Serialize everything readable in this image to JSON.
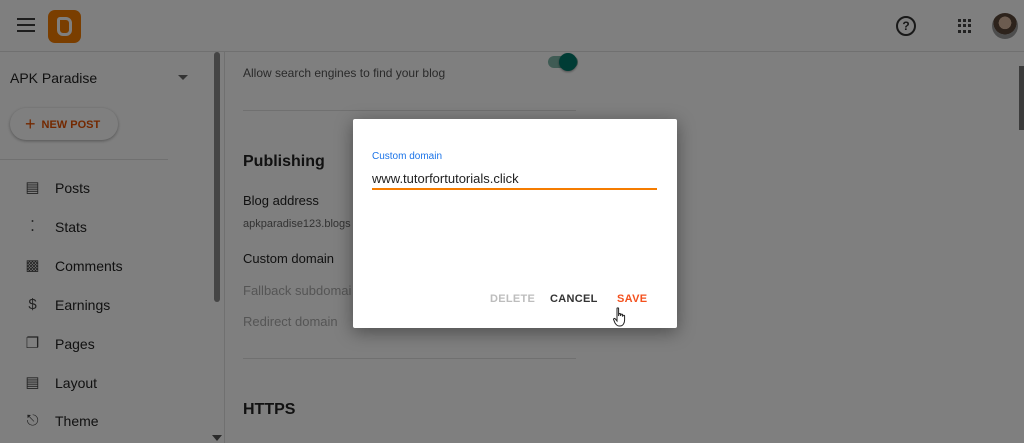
{
  "header": {
    "menu_icon": "hamburger-icon",
    "logo_icon": "blogger-logo",
    "help_icon": "help-circle-icon",
    "apps_icon": "grid-apps-icon"
  },
  "sidebar": {
    "blog_name": "APK Paradise",
    "new_post_label": "NEW POST",
    "items": [
      {
        "label": "Posts",
        "icon": "posts-icon"
      },
      {
        "label": "Stats",
        "icon": "stats-icon"
      },
      {
        "label": "Comments",
        "icon": "comments-icon"
      },
      {
        "label": "Earnings",
        "icon": "dollar-icon"
      },
      {
        "label": "Pages",
        "icon": "pages-icon"
      },
      {
        "label": "Layout",
        "icon": "layout-icon"
      },
      {
        "label": "Theme",
        "icon": "theme-icon"
      }
    ]
  },
  "settings": {
    "search_engines_text": "Allow search engines to find your blog",
    "search_engines_toggle": "on",
    "publishing_title": "Publishing",
    "blog_address_label": "Blog address",
    "blog_address_value": "apkparadise123.blogs",
    "custom_domain_label": "Custom domain",
    "fallback_label": "Fallback subdomai",
    "redirect_label": "Redirect domain",
    "https_title": "HTTPS"
  },
  "dialog": {
    "field_label": "Custom domain",
    "field_value": "www.tutorfortutorials.click",
    "delete_label": "DELETE",
    "cancel_label": "CANCEL",
    "save_label": "SAVE"
  },
  "colors": {
    "accent": "#f57c00",
    "save": "#f4511e",
    "field_label": "#1a73e8",
    "toggle": "#00796b"
  }
}
